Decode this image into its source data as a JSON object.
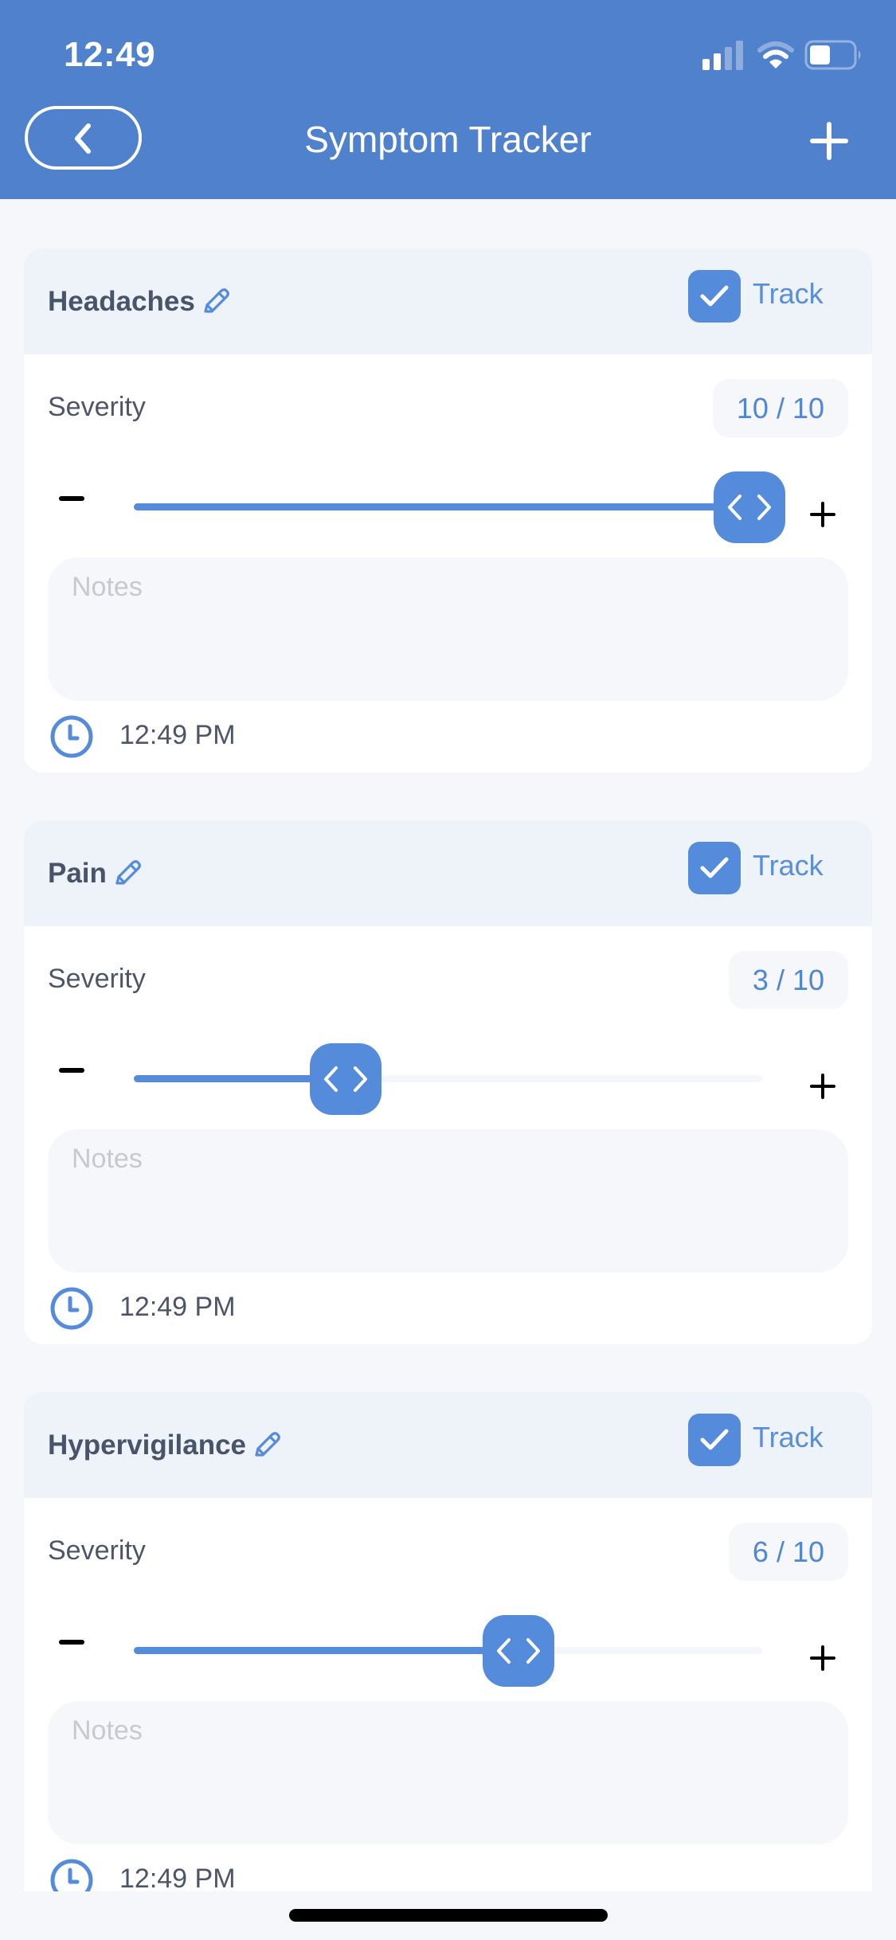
{
  "status_bar": {
    "time": "12:49",
    "signal_bars_filled": 2,
    "signal_bars_total": 4,
    "wifi_arcs_filled": 2,
    "wifi_arcs_total": 3,
    "battery_level": 0.4
  },
  "nav": {
    "title": "Symptom Tracker",
    "back_icon": "chevron-left-icon",
    "add_icon": "plus-icon"
  },
  "colors": {
    "accent": "#558bdb",
    "header_bg": "#4f81cd",
    "card_header_bg": "#eef2f9",
    "page_bg": "#f5f7fb",
    "title_text": "#48546a"
  },
  "symptoms": [
    {
      "name": "Headaches",
      "track_label": "Track",
      "tracked": true,
      "severity_label": "Severity",
      "severity_value": 10,
      "severity_max": 10,
      "severity_text": "10 / 10",
      "notes_placeholder": "Notes",
      "notes_value": "",
      "time": "12:49 PM"
    },
    {
      "name": "Pain",
      "track_label": "Track",
      "tracked": true,
      "severity_label": "Severity",
      "severity_value": 3,
      "severity_max": 10,
      "severity_text": "3 / 10",
      "notes_placeholder": "Notes",
      "notes_value": "",
      "time": "12:49 PM"
    },
    {
      "name": "Hypervigilance",
      "track_label": "Track",
      "tracked": true,
      "severity_label": "Severity",
      "severity_value": 6,
      "severity_max": 10,
      "severity_text": "6 / 10",
      "notes_placeholder": "Notes",
      "notes_value": "",
      "time": "12:49 PM"
    }
  ]
}
